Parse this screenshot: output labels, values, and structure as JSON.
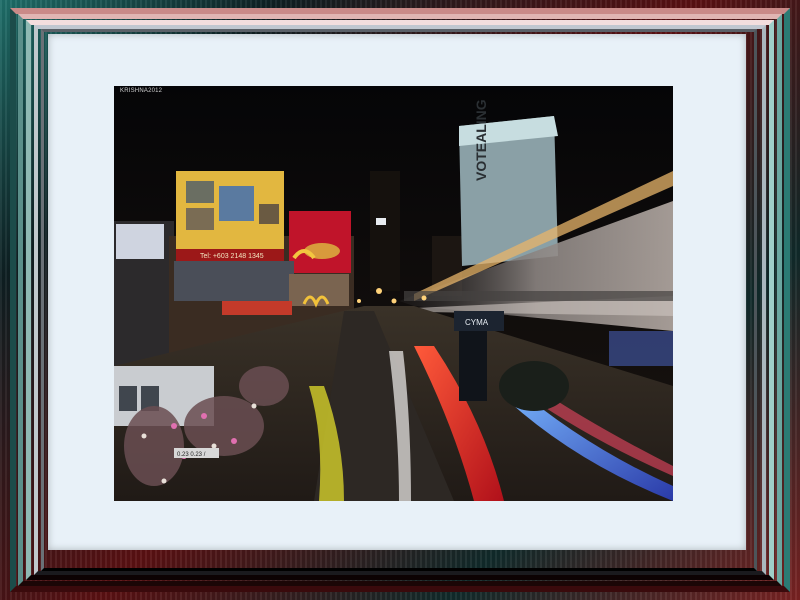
{
  "frame": {
    "outer_colors": [
      "#1f6f6a",
      "#5a1012",
      "#7a2222"
    ],
    "mat_color": "#e8f1f8"
  },
  "photo": {
    "watermark": "KRISHNA2012",
    "sign_text": "0.23 0.23 /",
    "billboard_text": "Tel: +603 2148 1345",
    "tower_text": "VOTEALING",
    "store_sign": "CYMA"
  }
}
